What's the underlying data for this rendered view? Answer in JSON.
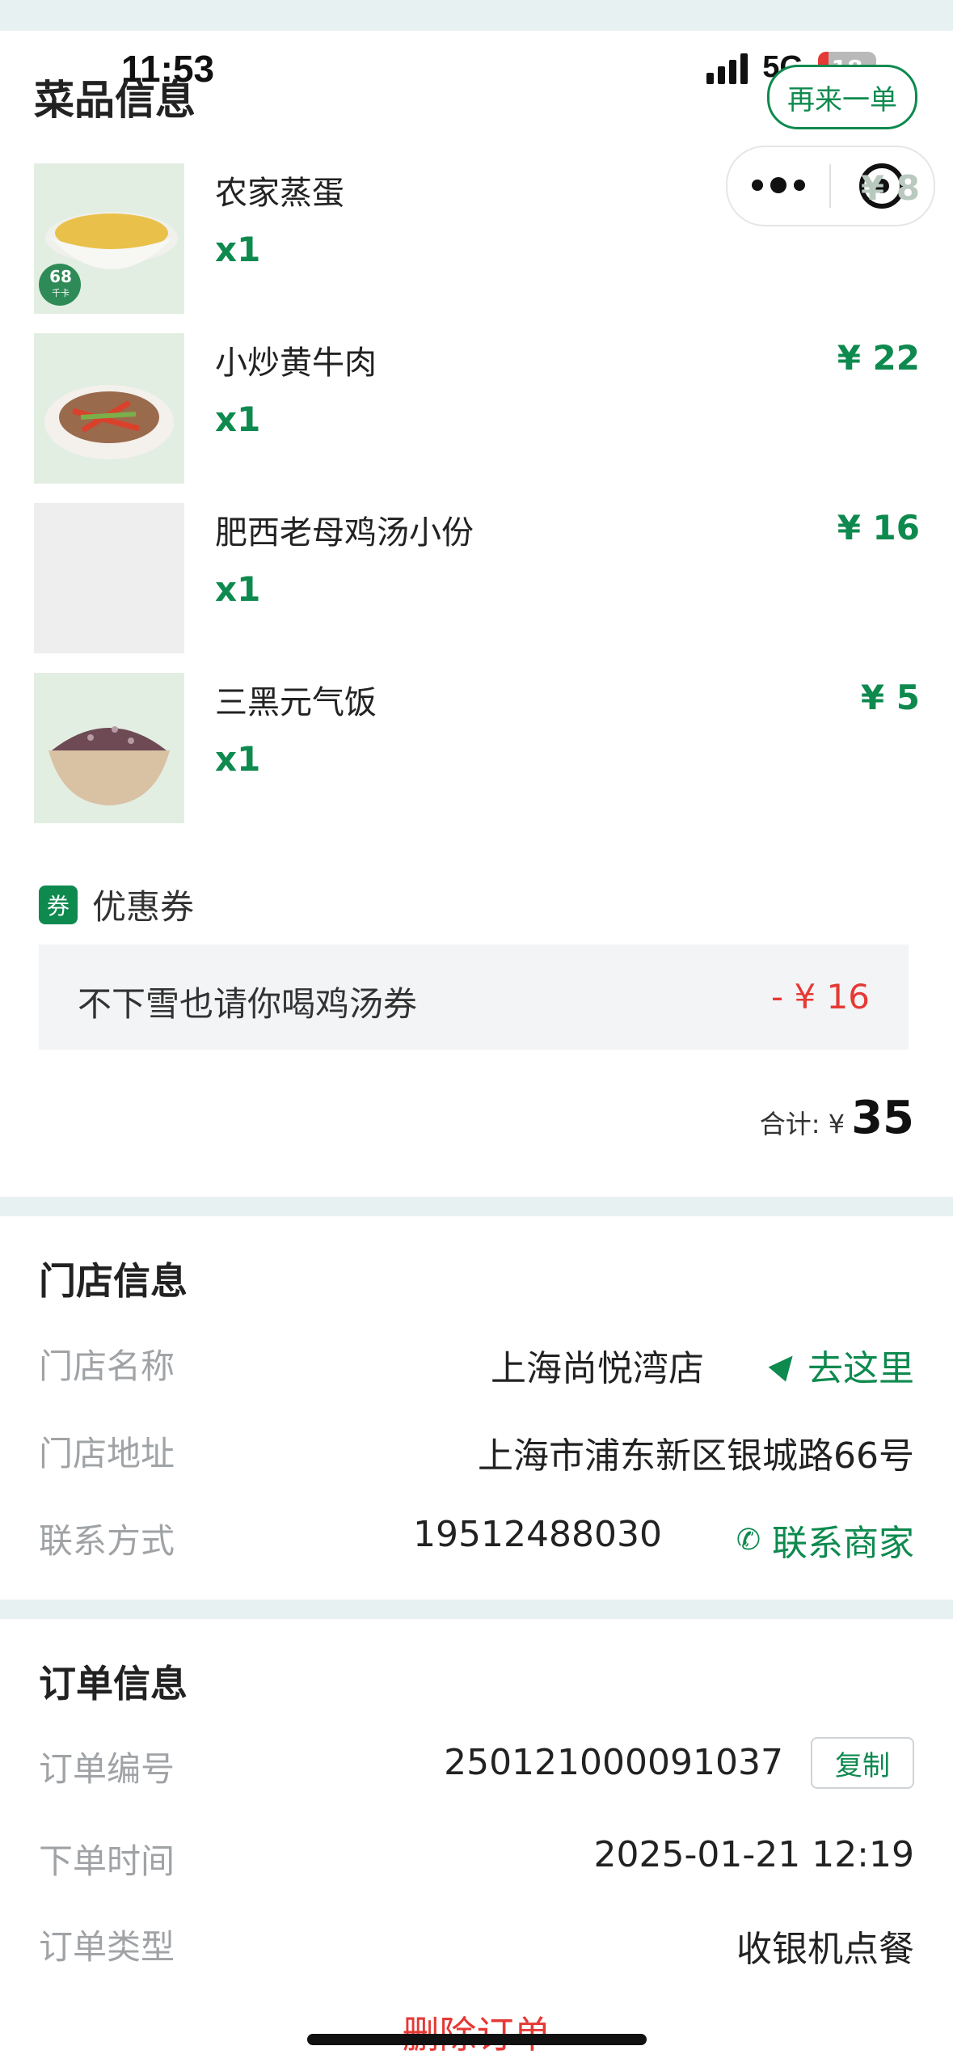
{
  "status_bar": {
    "time": "11:53",
    "network": "5G",
    "battery": "18"
  },
  "header": {
    "title": "菜品信息",
    "reorder_label": "再来一单"
  },
  "dishes": [
    {
      "name": "农家蒸蛋",
      "qty": "x1",
      "price": "¥ 8",
      "badge_kcal": "68",
      "badge_unit": "千卡"
    },
    {
      "name": "小炒黄牛肉",
      "qty": "x1",
      "price": "¥ 22"
    },
    {
      "name": "肥西老母鸡汤小份",
      "qty": "x1",
      "price": "¥ 16"
    },
    {
      "name": "三黑元气饭",
      "qty": "x1",
      "price": "¥ 5"
    }
  ],
  "coupon": {
    "icon_label": "券",
    "title": "优惠券",
    "name": "不下雪也请你喝鸡汤券",
    "amount": "- ¥ 16"
  },
  "total": {
    "label": "合计: ¥",
    "value": "35"
  },
  "store": {
    "title": "门店信息",
    "name_label": "门店名称",
    "name": "上海尚悦湾店",
    "go_label": "去这里",
    "address_label": "门店地址",
    "address": "上海市浦东新区银城路66号",
    "contact_label": "联系方式",
    "phone": "19512488030",
    "contact_btn": "联系商家"
  },
  "order": {
    "title": "订单信息",
    "no_label": "订单编号",
    "no": "250121000091037",
    "copy_label": "复制",
    "time_label": "下单时间",
    "time": "2025-01-21 12:19",
    "type_label": "订单类型",
    "type": "收银机点餐"
  },
  "delete_label": "删除订单",
  "colors": {
    "accent": "#0e8a4f",
    "danger": "#e53935",
    "muted": "#a0a3a6",
    "divider": "#e8f1f1"
  }
}
